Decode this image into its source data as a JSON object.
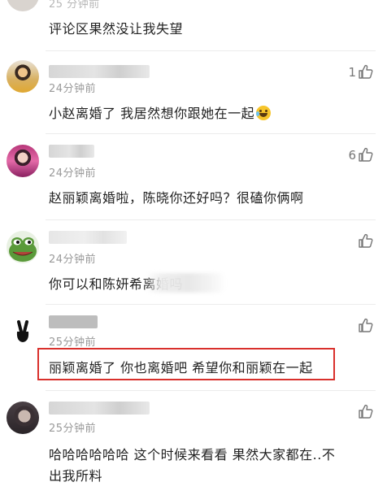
{
  "colors": {
    "highlight_border": "#d9302c",
    "time_text": "#9a9a9a",
    "body_text": "#222222",
    "like": "#777777"
  },
  "comments": [
    {
      "avatar": "partial-avatar",
      "time": "25 分钟前",
      "text": "评论区果然没让我失望",
      "like_count": ""
    },
    {
      "avatar": "photo-avatar-orange",
      "time": "24分钟前",
      "text": "小赵离婚了 我居然想你跟她在一起",
      "emoji": "laughing-crying-emoji",
      "like_count": "1"
    },
    {
      "avatar": "photo-avatar-pink",
      "time": "24分钟前",
      "text": "赵丽颖离婚啦，陈晓你还好吗？很磕你俩啊",
      "like_count": "6"
    },
    {
      "avatar": "frog-avatar",
      "time": "24分钟前",
      "text": "你可以和陈妍希离婚吗",
      "like_count": ""
    },
    {
      "avatar": "peace-hand-avatar",
      "time": "25分钟前",
      "text": "丽颖离婚了 你也离婚吧 希望你和丽颖在一起",
      "highlighted": true,
      "like_count": ""
    },
    {
      "avatar": "photo-avatar-dark",
      "time": "25分钟前",
      "text_line1": "哈哈哈哈哈哈  这个时候来看看  果然大家都在..不",
      "text_line2": "出我所料",
      "like_count": ""
    }
  ]
}
